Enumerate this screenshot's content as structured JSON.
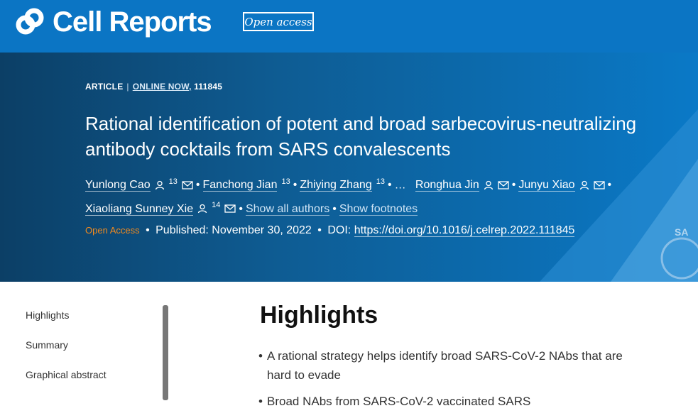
{
  "header": {
    "brand": "Cell Reports",
    "badge": "Open access"
  },
  "article": {
    "type": "ARTICLE",
    "separator": "|",
    "status": "ONLINE NOW,",
    "number": "111845",
    "title": "Rational identification of potent and broad sarbecovirus-neutralizing antibody cocktails from SARS convalescents",
    "authors_line1": [
      {
        "name": "Yunlong Cao",
        "sup": "13"
      },
      {
        "name": "Fanchong Jian",
        "sup": "13"
      },
      {
        "name": "Zhiying Zhang",
        "sup": "13"
      }
    ],
    "ellipsis": "…",
    "authors_line1b": [
      {
        "name": "Ronghua Jin"
      },
      {
        "name": "Junyu Xiao"
      }
    ],
    "authors_line2": [
      {
        "name": "Xiaoliang Sunney Xie",
        "sup": "14"
      }
    ],
    "show_all_authors": "Show all authors",
    "show_footnotes": "Show footnotes",
    "open_access_label": "Open Access",
    "published_label": "Published: November 30, 2022",
    "doi_label": "DOI:",
    "doi_url": "https://doi.org/10.1016/j.celrep.2022.111845"
  },
  "sidenav": {
    "items": [
      "Highlights",
      "Summary",
      "Graphical abstract"
    ]
  },
  "main": {
    "heading": "Highlights",
    "highlights": [
      "A rational strategy helps identify broad SARS-CoV-2 NAbs that are hard to evade",
      "Broad NAbs from SARS-CoV-2 vaccinated SARS"
    ]
  },
  "colors": {
    "brand_blue": "#0b75c4",
    "hero_dark": "#0c3f66",
    "open_access_orange": "#f28a1e"
  },
  "icons": [
    "cell-logo-icon",
    "person-icon",
    "mail-icon"
  ]
}
